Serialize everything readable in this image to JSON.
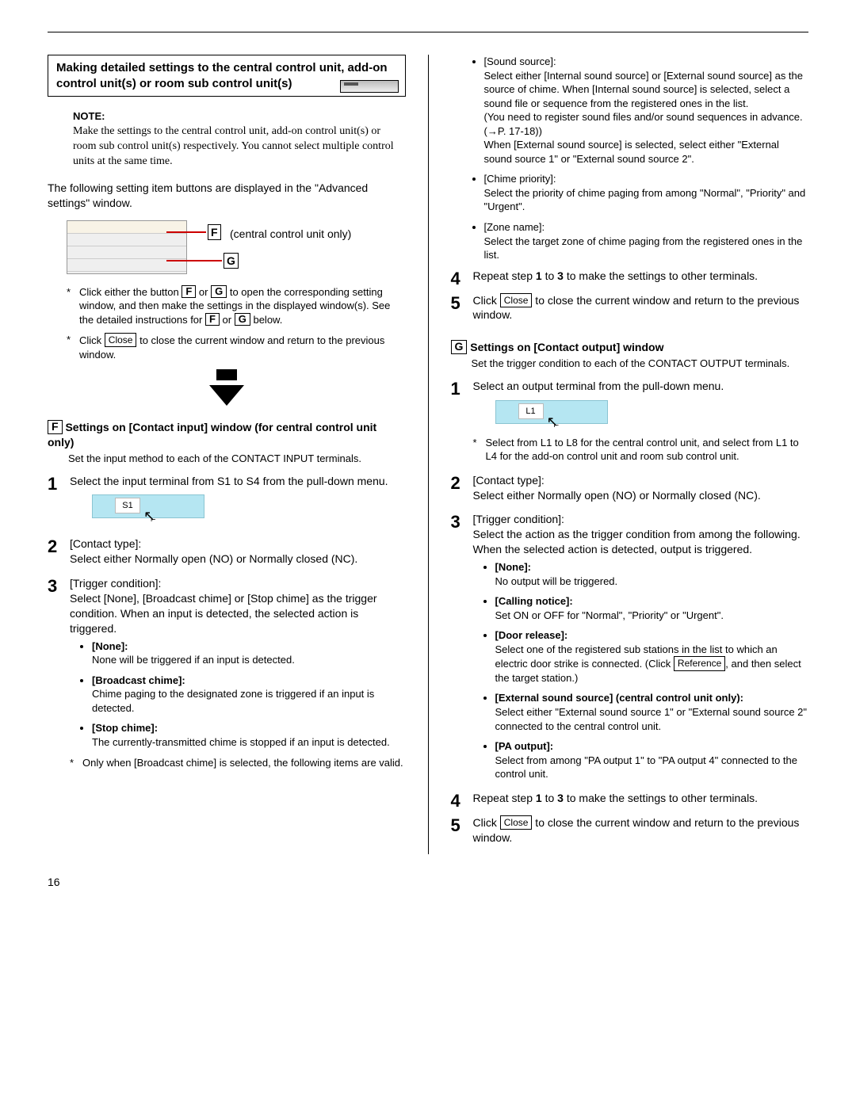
{
  "page_number": "16",
  "title_box": "Making detailed settings to the central control unit, add-on control unit(s) or room sub control unit(s)",
  "note_label": "NOTE:",
  "note_body": "Make the settings to the central control unit, add-on control unit(s) or room sub control unit(s) respectively. You cannot select multiple control units at the same time.",
  "intro_para": "The following setting item buttons are displayed in the \"Advanced settings\" window.",
  "f_label": "F",
  "g_label": "G",
  "f_caption": "(central control unit only)",
  "star_left": {
    "a_pre": "Click either the button ",
    "a_mid": " or ",
    "a_post": " to open the corresponding setting window, and then make the settings in the displayed window(s). See the detailed instructions for ",
    "a_mid2": " or ",
    "a_end": " below.",
    "b_pre": "Click ",
    "b_btn": "Close",
    "b_post": " to close the current window and return to the previous window."
  },
  "section_f": {
    "title": "Settings on [Contact input] window (for central control unit only)",
    "desc": "Set the input method to each of the CONTACT INPUT terminals.",
    "step1": "Select the input terminal from S1 to S4 from the pull-down menu.",
    "drop_label": "S1",
    "step2": {
      "head": "[Contact type]:",
      "body": "Select either Normally open (NO) or Normally closed (NC)."
    },
    "step3": {
      "head": "[Trigger condition]:",
      "body": "Select [None], [Broadcast chime] or [Stop chime] as the trigger condition. When an input is detected, the selected action is triggered."
    },
    "bullets": [
      {
        "t": "[None]:",
        "d": "None will be triggered if an input is detected."
      },
      {
        "t": "[Broadcast chime]:",
        "d": "Chime paging to the designated zone is triggered if an input is detected."
      },
      {
        "t": "[Stop chime]:",
        "d": "The currently-transmitted chime is stopped if an input is detected."
      }
    ],
    "star_note": "Only when [Broadcast chime] is selected, the following items are valid."
  },
  "right_bullets_top": [
    {
      "t": "[Sound source]:",
      "d": "Select either [Internal sound source] or [External sound source] as the source of chime. When [Internal sound source] is selected, select a sound file or sequence from the registered ones in the list.\n(You need to register sound files and/or sound sequences in advance. (→P. 17-18))\nWhen [External sound source] is selected, select either \"External sound source 1\" or \"External sound source 2\"."
    },
    {
      "t": "[Chime priority]:",
      "d": "Select the priority of chime paging from among \"Normal\", \"Priority\" and \"Urgent\"."
    },
    {
      "t": "[Zone name]:",
      "d": "Select the target zone of chime paging from the registered ones in the list."
    }
  ],
  "right_steps_top": {
    "s4_pre": "Repeat step ",
    "s4_b1": "1",
    "s4_mid": " to ",
    "s4_b2": "3",
    "s4_post": " to make the settings to other terminals.",
    "s5_pre": "Click ",
    "s5_btn": "Close",
    "s5_post": " to close the current window and return to the previous window."
  },
  "section_g": {
    "title": "Settings on [Contact output] window",
    "desc": "Set the trigger condition to each of the CONTACT OUTPUT terminals.",
    "step1": "Select an output terminal from the pull-down menu.",
    "drop_label": "L1",
    "star": "Select from L1 to L8 for the central control unit, and select from L1 to L4 for the add-on control unit and room sub control unit.",
    "step2": {
      "head": "[Contact type]:",
      "body": "Select either Normally open (NO) or Normally closed (NC)."
    },
    "step3": {
      "head": "[Trigger condition]:",
      "body": "Select the action as the trigger condition from among the following. When the selected action is detected, output is triggered."
    },
    "bullets": [
      {
        "t": "[None]:",
        "d": "No output will be triggered."
      },
      {
        "t": "[Calling notice]:",
        "d": "Set ON or OFF for \"Normal\", \"Priority\" or \"Urgent\"."
      },
      {
        "t": "[Door release]:",
        "d_pre": "Select one of the registered sub stations in the list to which an electric door strike is connected. (Click ",
        "d_btn": "Reference",
        "d_post": ", and then select the target station.)"
      },
      {
        "t": "[External sound source] (central control unit only):",
        "d": "Select either \"External sound source 1\" or \"External sound source 2\" connected to the central control unit."
      },
      {
        "t": "[PA output]:",
        "d": "Select from among \"PA output 1\" to \"PA output 4\" connected to the control unit."
      }
    ]
  },
  "right_steps_bottom": {
    "s4_pre": "Repeat step ",
    "s4_b1": "1",
    "s4_mid": " to ",
    "s4_b2": "3",
    "s4_post": " to make the settings to other terminals.",
    "s5_pre": "Click ",
    "s5_btn": "Close",
    "s5_post": " to close the current window and return to the previous window."
  }
}
